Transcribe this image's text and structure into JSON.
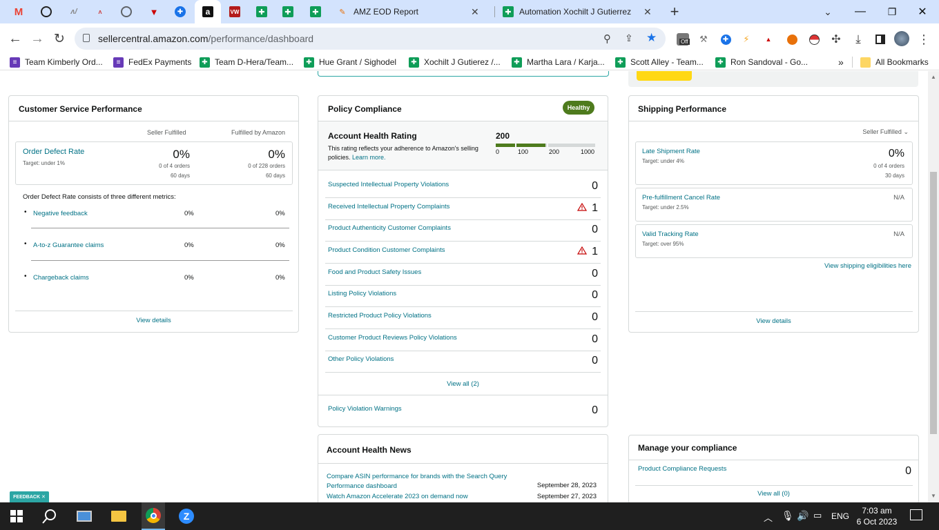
{
  "tabs": [
    {
      "icon": "gmail-icon",
      "title": ""
    },
    {
      "icon": "chatgpt-icon",
      "title": ""
    },
    {
      "icon": "signature-icon",
      "title": ""
    },
    {
      "icon": "signature-icon",
      "title": ""
    },
    {
      "icon": "globe-icon",
      "title": ""
    },
    {
      "icon": "helium-icon",
      "title": ""
    },
    {
      "icon": "aks-icon",
      "title": ""
    },
    {
      "icon": "amazon-icon",
      "title": ""
    },
    {
      "icon": "vw-icon",
      "title": ""
    },
    {
      "icon": "sheets-icon",
      "title": ""
    },
    {
      "icon": "sheets-icon",
      "title": ""
    },
    {
      "icon": "sheets-icon",
      "title": ""
    },
    {
      "icon": "pencil-icon",
      "title": "AMZ EOD Report"
    },
    {
      "icon": "sheets-icon",
      "title": "Automation Xochilt J Gutierrez"
    }
  ],
  "address": {
    "domain": "sellercentral.amazon.com",
    "path": "/performance/dashboard"
  },
  "extensions": {
    "off_badge": "Off"
  },
  "bookmarks": [
    {
      "label": "Team Kimberly Ord...",
      "icon": "form-icon"
    },
    {
      "label": "FedEx Payments",
      "icon": "form-icon"
    },
    {
      "label": "Team D-Hera/Team...",
      "icon": "sheets-icon"
    },
    {
      "label": "Hue Grant / Sighodel",
      "icon": "sheets-icon"
    },
    {
      "label": "Xochilt J Gutierez /...",
      "icon": "sheets-icon"
    },
    {
      "label": "Martha Lara / Karja...",
      "icon": "sheets-icon"
    },
    {
      "label": "Scott Alley - Team...",
      "icon": "sheets-icon"
    },
    {
      "label": "Ron Sandoval - Go...",
      "icon": "sheets-icon"
    }
  ],
  "all_bookmarks": "All Bookmarks",
  "customer_service": {
    "title": "Customer Service Performance",
    "col1": "Seller Fulfilled",
    "col2": "Fulfilled by Amazon",
    "odr_label": "Order Defect Rate",
    "odr_target": "Target: under 1%",
    "sf_value": "0%",
    "sf_orders": "0 of 4 orders",
    "sf_days": "60 days",
    "fba_value": "0%",
    "fba_orders": "0 of 228 orders",
    "fba_days": "60 days",
    "consists": "Order Defect Rate consists of three different metrics:",
    "metrics": [
      {
        "label": "Negative feedback",
        "sf": "0%",
        "fba": "0%"
      },
      {
        "label": "A-to-z Guarantee claims",
        "sf": "0%",
        "fba": "0%"
      },
      {
        "label": "Chargeback claims",
        "sf": "0%",
        "fba": "0%"
      }
    ],
    "view_details": "View details"
  },
  "policy": {
    "title": "Policy Compliance",
    "badge": "Healthy",
    "ahr_title": "Account Health Rating",
    "ahr_desc": "This rating reflects your adherence to Amazon's selling policies.",
    "learn_more": "Learn more.",
    "ahr_score": "200",
    "ahr_fill_fraction": 0.2,
    "scale": [
      "0",
      "100",
      "200",
      "1000"
    ],
    "rows": [
      {
        "label": "Suspected Intellectual Property Violations",
        "value": "0",
        "warn": false
      },
      {
        "label": "Received Intellectual Property Complaints",
        "value": "1",
        "warn": true
      },
      {
        "label": "Product Authenticity Customer Complaints",
        "value": "0",
        "warn": false
      },
      {
        "label": "Product Condition Customer Complaints",
        "value": "1",
        "warn": true
      },
      {
        "label": "Food and Product Safety Issues",
        "value": "0",
        "warn": false
      },
      {
        "label": "Listing Policy Violations",
        "value": "0",
        "warn": false
      },
      {
        "label": "Restricted Product Policy Violations",
        "value": "0",
        "warn": false
      },
      {
        "label": "Customer Product Reviews Policy Violations",
        "value": "0",
        "warn": false
      },
      {
        "label": "Other Policy Violations",
        "value": "0",
        "warn": false
      }
    ],
    "view_all": "View all (2)",
    "warnings_label": "Policy Violation Warnings",
    "warnings_value": "0"
  },
  "news": {
    "title": "Account Health News",
    "items": [
      {
        "text": "Compare ASIN performance for brands with the Search Query Performance dashboard",
        "date": "September 28, 2023"
      },
      {
        "text": "Watch Amazon Accelerate 2023 on demand now",
        "date": "September 27, 2023"
      }
    ]
  },
  "shipping": {
    "title": "Shipping Performance",
    "filter": "Seller Fulfilled",
    "late_label": "Late Shipment Rate",
    "late_target": "Target: under 4%",
    "late_value": "0%",
    "late_orders": "0 of 4 orders",
    "late_days": "30 days",
    "cancel_label": "Pre-fulfillment Cancel Rate",
    "cancel_target": "Target: under 2.5%",
    "cancel_value": "N/A",
    "vtr_label": "Valid Tracking Rate",
    "vtr_target": "Target: over 95%",
    "vtr_value": "N/A",
    "eligibilities": "View shipping eligibilities here",
    "view_details": "View details"
  },
  "compliance": {
    "title": "Manage your compliance",
    "row_label": "Product Compliance Requests",
    "row_value": "0",
    "view_all": "View all (0)"
  },
  "feedback": "FEEDBACK",
  "taskbar": {
    "lang": "ENG",
    "time": "7:03 am",
    "date": "6 Oct 2023"
  }
}
